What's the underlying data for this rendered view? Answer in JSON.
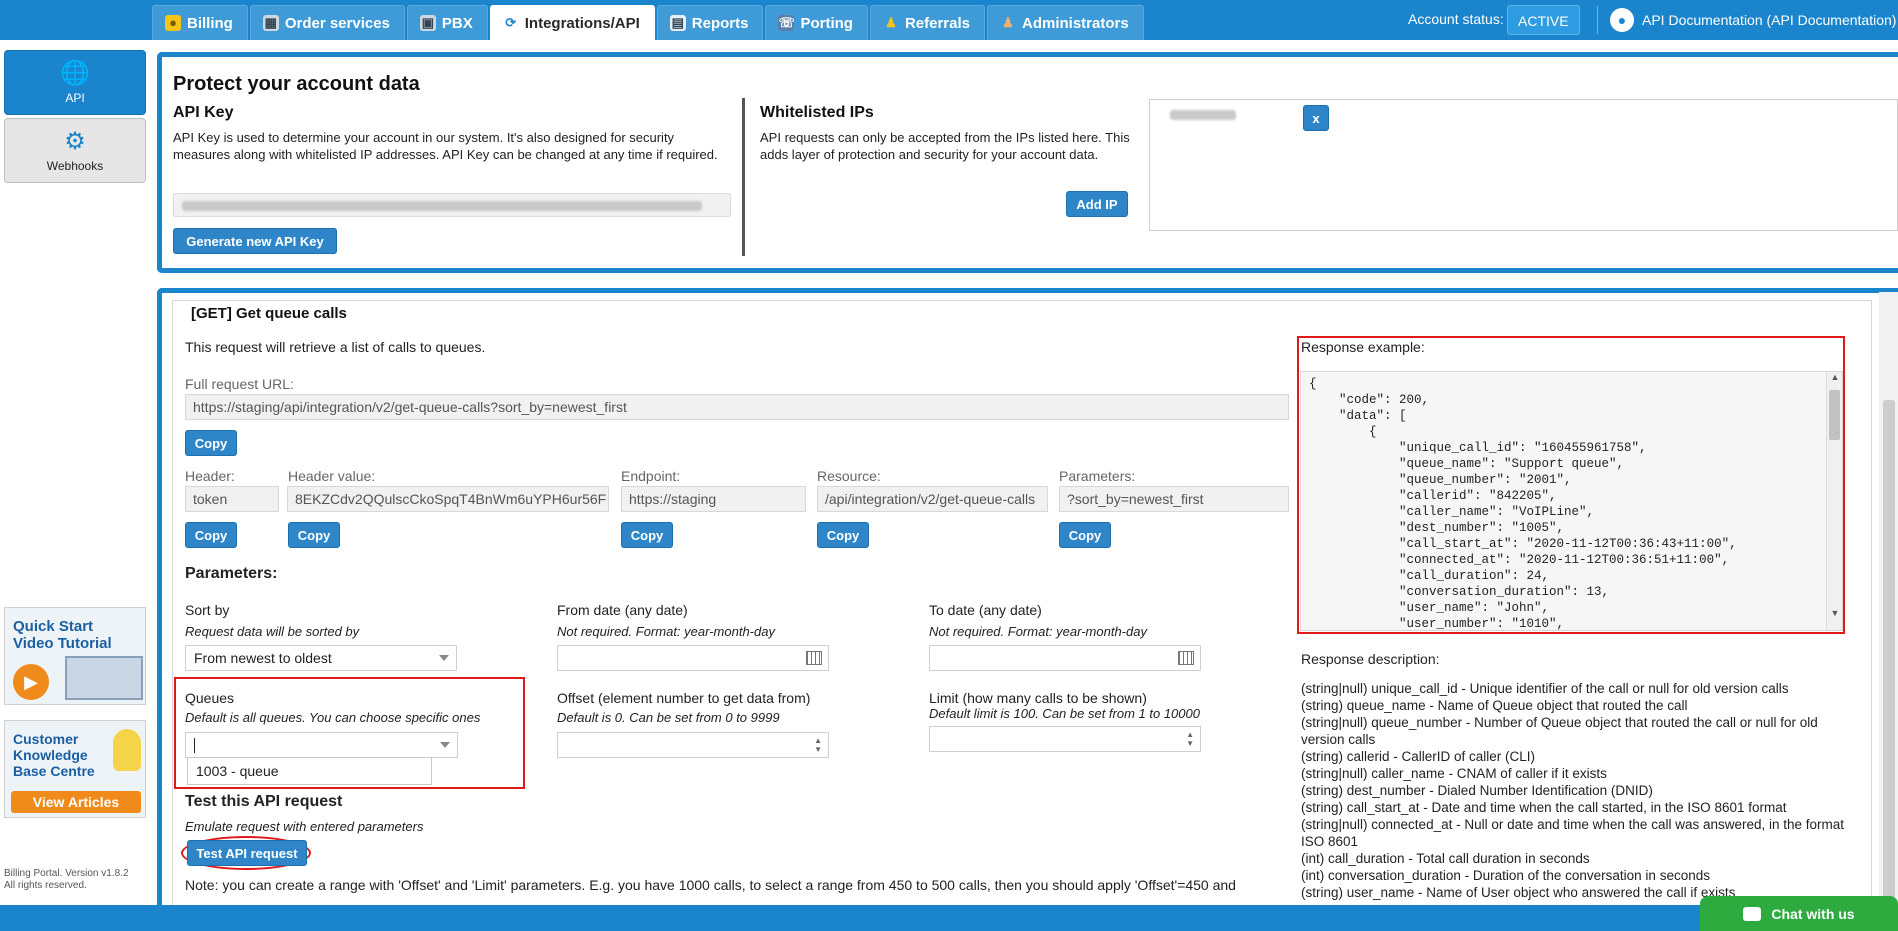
{
  "nav": {
    "tabs": [
      {
        "label": "Billing",
        "icon": "billing-icon"
      },
      {
        "label": "Order services",
        "icon": "order-services-icon"
      },
      {
        "label": "PBX",
        "icon": "pbx-icon"
      },
      {
        "label": "Integrations/API",
        "icon": "integrations-icon",
        "active": true
      },
      {
        "label": "Reports",
        "icon": "reports-icon"
      },
      {
        "label": "Porting",
        "icon": "porting-icon"
      },
      {
        "label": "Referrals",
        "icon": "referrals-icon"
      },
      {
        "label": "Administrators",
        "icon": "administrators-icon"
      }
    ],
    "account_status_label": "Account status:",
    "account_status": "ACTIVE",
    "user": "API Documentation (API Documentation)"
  },
  "sidebar": {
    "items": [
      {
        "label": "API",
        "icon": "globe-icon"
      },
      {
        "label": "Webhooks",
        "icon": "gear-icon"
      }
    ],
    "promo_video": "Quick Start Video Tutorial",
    "promo_kb": "Customer Knowledge Base Centre",
    "promo_kb_button": "View Articles",
    "version": "Billing Portal. Version v1.8.2",
    "rights": "All rights reserved."
  },
  "protect": {
    "title": "Protect your account data",
    "api_key_title": "API Key",
    "api_key_text": "API Key is used to determine your account in our system. It's also designed for security measures along with whitelisted IP addresses. API Key can be changed at any time if required.",
    "generate_button": "Generate new API Key",
    "whitelist_title": "Whitelisted IPs",
    "whitelist_text": "API requests can only be accepted from the IPs listed here. This adds layer of protection and security for your account data.",
    "add_ip_button": "Add IP",
    "remove_ip_button": "x"
  },
  "endpoint": {
    "title": "[GET] Get queue calls",
    "description": "This request will retrieve a list of calls to queues.",
    "full_url_label": "Full request URL:",
    "full_url": "https://staging/api/integration/v2/get-queue-calls?sort_by=newest_first",
    "copy": "Copy",
    "header_label": "Header:",
    "header": "token",
    "header_value_label": "Header value:",
    "header_value": "8EKZCdv2QQulscCkoSpqT4BnWm6uYPH6ur56F",
    "endpoint_label": "Endpoint:",
    "endpoint": "https://staging",
    "resource_label": "Resource:",
    "resource": "/api/integration/v2/get-queue-calls",
    "parameters_label": "Parameters:",
    "parameters": "?sort_by=newest_first",
    "params_title": "Parameters:",
    "sort_label": "Sort by",
    "sort_hint": "Request data will be sorted by",
    "sort_value": "From newest to oldest",
    "from_label": "From date (any date)",
    "from_hint": "Not required. Format: year-month-day",
    "to_label": "To date (any date)",
    "to_hint": "Not required. Format: year-month-day",
    "queues_label": "Queues",
    "queues_hint": "Default is all queues. You can choose specific ones",
    "queues_option": "1003 - queue",
    "offset_label": "Offset (element number to get data from)",
    "offset_hint": "Default is 0. Can be set from 0 to 9999",
    "limit_label": "Limit (how many calls to be shown)",
    "limit_hint": "Default limit is 100. Can be set from 1 to 10000",
    "test_title": "Test this API request",
    "test_hint": "Emulate request with entered parameters",
    "test_button": "Test API request",
    "note": "Note: you can create a range with 'Offset' and 'Limit' parameters. E.g. you have 1000 calls, to select a range from 450 to 500 calls, then you should apply 'Offset'=450 and"
  },
  "response": {
    "example_label": "Response example:",
    "code": "{\n    \"code\": 200,\n    \"data\": [\n        {\n            \"unique_call_id\": \"160455961758\",\n            \"queue_name\": \"Support queue\",\n            \"queue_number\": \"2001\",\n            \"callerid\": \"842205\",\n            \"caller_name\": \"VoIPLine\",\n            \"dest_number\": \"1005\",\n            \"call_start_at\": \"2020-11-12T00:36:43+11:00\",\n            \"connected_at\": \"2020-11-12T00:36:51+11:00\",\n            \"call_duration\": 24,\n            \"conversation_duration\": 13,\n            \"user_name\": \"John\",\n            \"user_number\": \"1010\",",
    "description_label": "Response description:",
    "descriptions": [
      "(string|null) unique_call_id - Unique identifier of the call or null for old version calls",
      "(string) queue_name - Name of Queue object that routed the call",
      "(string|null) queue_number - Number of Queue object that routed the call or null for old version calls",
      "(string) callerid - CallerID of caller (CLI)",
      "(string|null) caller_name - CNAM of caller if it exists",
      "(string) dest_number - Dialed Number Identification (DNID)",
      "(string) call_start_at - Date and time when the call started, in the ISO 8601 format",
      "(string|null) connected_at - Null or date and time when the call was answered, in the format ISO 8601",
      "(int) call_duration - Total call duration in seconds",
      "(int) conversation_duration - Duration of the conversation in seconds",
      "(string) user_name - Name of User object who answered the call if exists"
    ]
  },
  "chat": {
    "label": "Chat with us"
  }
}
